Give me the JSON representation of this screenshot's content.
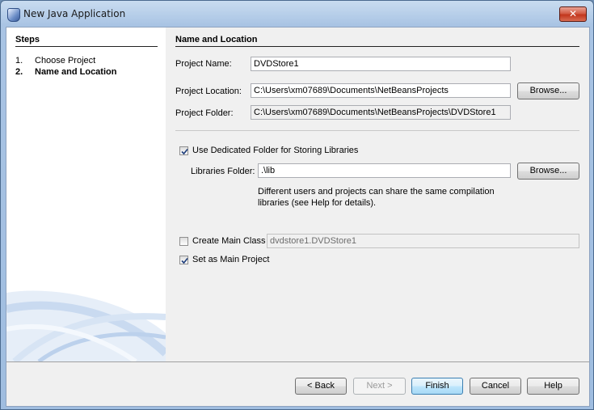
{
  "window": {
    "title": "New Java Application",
    "close_icon": "close-icon"
  },
  "steps": {
    "heading": "Steps",
    "items": [
      {
        "num": "1.",
        "label": "Choose Project"
      },
      {
        "num": "2.",
        "label": "Name and Location"
      }
    ]
  },
  "main": {
    "heading": "Name and Location",
    "project_name_label": "Project Name:",
    "project_name_value": "DVDStore1",
    "project_location_label": "Project Location:",
    "project_location_value": "C:\\Users\\xm07689\\Documents\\NetBeansProjects",
    "browse_label": "Browse...",
    "project_folder_label": "Project Folder:",
    "project_folder_value": "C:\\Users\\xm07689\\Documents\\NetBeansProjects\\DVDStore1",
    "dedicated_folder_label": "Use Dedicated Folder for Storing Libraries",
    "dedicated_folder_checked": true,
    "libraries_folder_label": "Libraries Folder:",
    "libraries_folder_value": ".\\lib",
    "libraries_browse_label": "Browse...",
    "libraries_note_line1": "Different users and projects can share the same compilation",
    "libraries_note_line2": "libraries (see Help for details).",
    "create_main_class_label": "Create Main Class",
    "create_main_class_checked": false,
    "main_class_value": "dvdstore1.DVDStore1",
    "set_main_project_label": "Set as Main Project",
    "set_main_project_checked": true
  },
  "buttons": {
    "back": "< Back",
    "next": "Next >",
    "finish": "Finish",
    "cancel": "Cancel",
    "help": "Help"
  }
}
